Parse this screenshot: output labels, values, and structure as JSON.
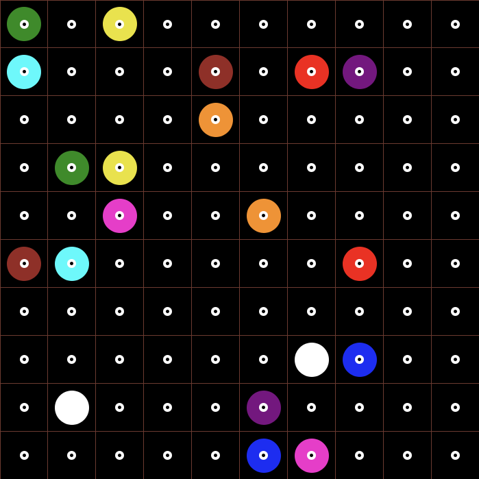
{
  "board": {
    "rows": 10,
    "cols": 10,
    "colors": {
      "green": "#3f8a2b",
      "yellow": "#e9e24e",
      "cyan": "#6ef8fb",
      "brown": "#8e3028",
      "red": "#e93224",
      "purple": "#73187e",
      "orange": "#ee9337",
      "magenta": "#e53ec8",
      "white": "#ffffff",
      "blue": "#1d2df0"
    },
    "grid_line_color": "#6b3a30",
    "cells": [
      [
        "green",
        null,
        "yellow",
        null,
        null,
        null,
        null,
        null,
        null,
        null
      ],
      [
        "cyan",
        null,
        null,
        null,
        "brown",
        null,
        "red",
        "purple",
        null,
        null
      ],
      [
        null,
        null,
        null,
        null,
        "orange",
        null,
        null,
        null,
        null,
        null
      ],
      [
        null,
        "green",
        "yellow",
        null,
        null,
        null,
        null,
        null,
        null,
        null
      ],
      [
        null,
        null,
        "magenta",
        null,
        null,
        "orange",
        null,
        null,
        null,
        null
      ],
      [
        "brown",
        "cyan",
        null,
        null,
        null,
        null,
        null,
        "red",
        null,
        null
      ],
      [
        null,
        null,
        null,
        null,
        null,
        null,
        null,
        null,
        null,
        null
      ],
      [
        null,
        null,
        null,
        null,
        null,
        null,
        "white",
        "blue",
        null,
        null
      ],
      [
        null,
        "white",
        null,
        null,
        null,
        "purple",
        null,
        null,
        null,
        null
      ],
      [
        null,
        null,
        null,
        null,
        null,
        "blue",
        "magenta",
        null,
        null,
        null
      ]
    ]
  }
}
